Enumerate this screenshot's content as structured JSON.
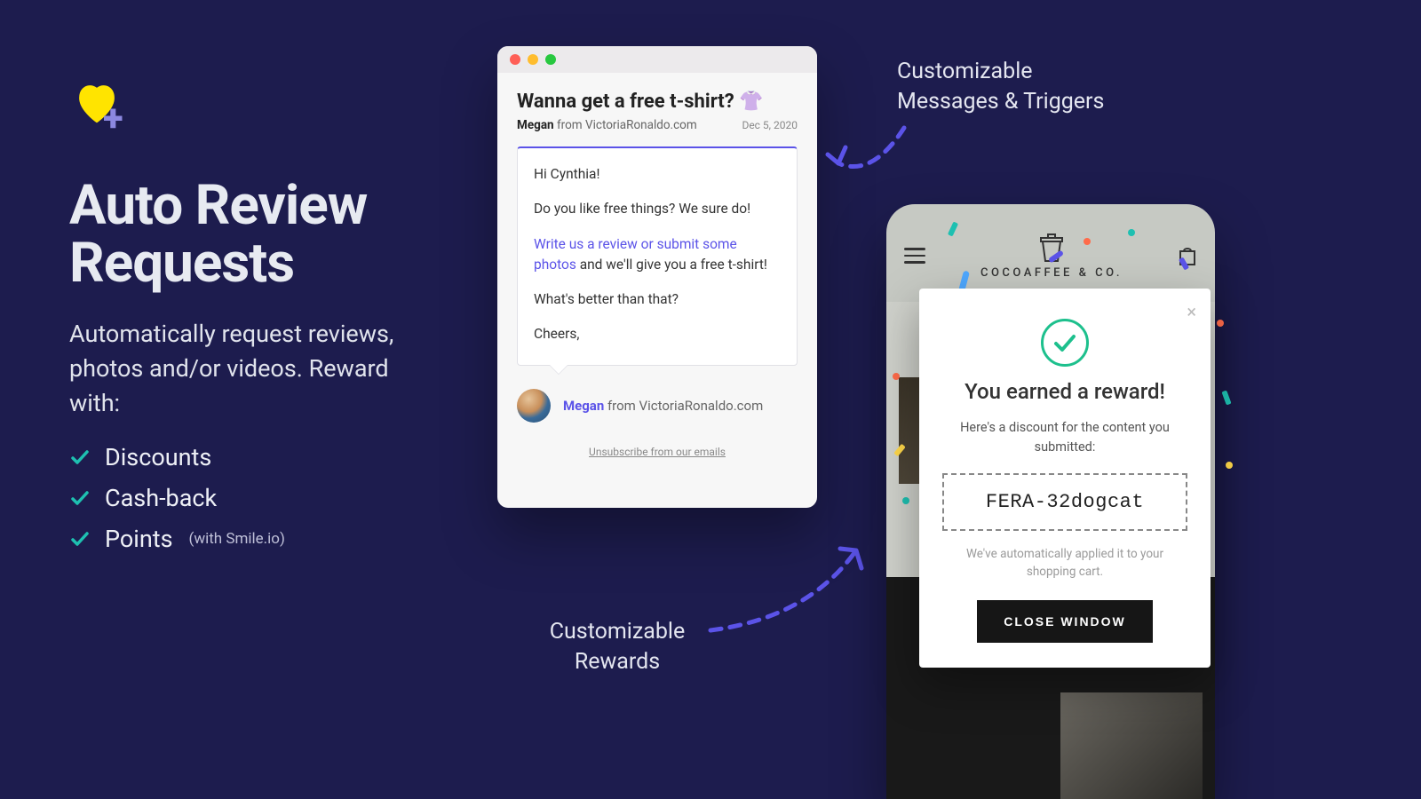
{
  "left": {
    "title_line1": "Auto Review",
    "title_line2": "Requests",
    "subtitle": "Automatically request reviews, photos and/or videos. Reward with:",
    "bullets": [
      {
        "label": "Discounts"
      },
      {
        "label": "Cash-back"
      },
      {
        "label": "Points",
        "small": "(with Smile.io)"
      }
    ]
  },
  "email": {
    "subject": "Wanna get a free t-shirt? 👚",
    "sender_name": "Megan",
    "sender_prefix": " from ",
    "sender_domain": "VictoriaRonaldo.com",
    "date": "Dec 5, 2020",
    "greeting": "Hi Cynthia!",
    "line1": "Do you like free things? We sure do!",
    "link_text": "Write us a review or submit some photos",
    "line2_suffix": " and we'll give you a free t-shirt!",
    "line3": "What's better than that?",
    "signoff": "Cheers,",
    "sig_name": "Megan",
    "sig_suffix": " from VictoriaRonaldo.com",
    "unsubscribe": "Unsubscribe from our emails"
  },
  "callouts": {
    "top_right_line1": "Customizable",
    "top_right_line2": "Messages & Triggers",
    "bottom_left_line1": "Customizable",
    "bottom_left_line2": "Rewards"
  },
  "phone": {
    "brand": "COCOAFFEE & CO."
  },
  "modal": {
    "title": "You earned a reward!",
    "lead": "Here's a discount for the content you submitted:",
    "code": "FERA-32dogcat",
    "note": "We've automatically applied it to your shopping cart.",
    "button": "CLOSE WINDOW"
  },
  "colors": {
    "accent": "#5b53e8",
    "teal": "#1ec0b1",
    "green": "#1dc08d"
  }
}
